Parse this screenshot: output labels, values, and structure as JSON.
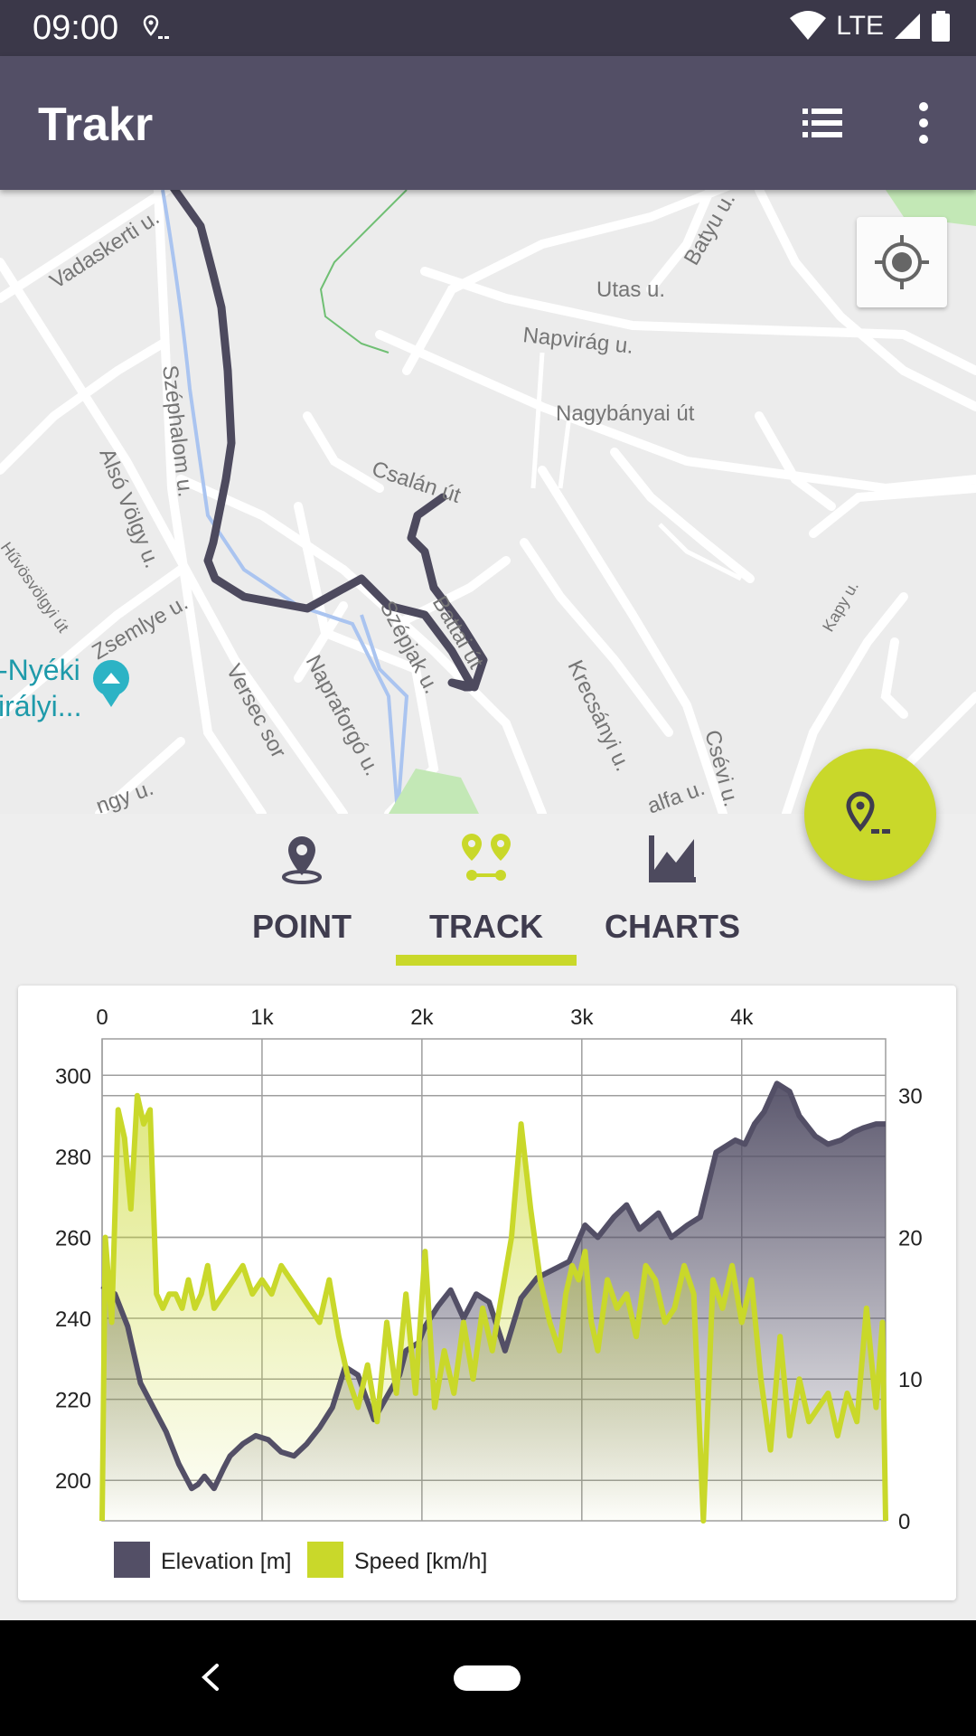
{
  "status_bar": {
    "time": "09:00",
    "network": "LTE"
  },
  "app_bar": {
    "title": "Trakr"
  },
  "map": {
    "street_labels": [
      "Vadaskerti u.",
      "Batyu u.",
      "Utas u.",
      "Napvirág u.",
      "Nagybányai út",
      "Szép­halom u.",
      "Alsó Völgy u.",
      "Csalán út",
      "Hűvösvölgyi út",
      "Zsemlye u.",
      "Szépjak u.",
      "Battai út",
      "Napraforgó u.",
      "Versec sor",
      "Krecsányi u.",
      "Csévi u.",
      "Kapy u.",
      "alfa u.",
      "ngy u."
    ],
    "poi_label_line1": "-Nyéki",
    "poi_label_line2": "irályi..."
  },
  "tabs": [
    {
      "label": "POINT",
      "icon": "map-pin-icon"
    },
    {
      "label": "TRACK",
      "icon": "track-icon"
    },
    {
      "label": "CHARTS",
      "icon": "chart-icon"
    }
  ],
  "active_tab": "TRACK",
  "colors": {
    "primary": "#534f66",
    "accent": "#c9d82a",
    "elevation": "#534f66",
    "speed": "#c9d82a"
  },
  "chart_data": {
    "type": "line",
    "x_label_unit": "m",
    "x_ticks": [
      "0",
      "1k",
      "2k",
      "3k",
      "4k"
    ],
    "x_range": [
      0,
      4900
    ],
    "y_left_ticks": [
      "300",
      "280",
      "260",
      "240",
      "220",
      "200"
    ],
    "y_left_range": [
      190,
      309
    ],
    "y_right_ticks": [
      "30",
      "20",
      "10",
      "0"
    ],
    "y_right_range": [
      0,
      34
    ],
    "grid": true,
    "legend_position": "bottom-left",
    "series": [
      {
        "name": "Elevation [m]",
        "axis": "left",
        "x": [
          0,
          80,
          160,
          240,
          320,
          400,
          480,
          560,
          600,
          640,
          700,
          760,
          800,
          880,
          960,
          1040,
          1120,
          1200,
          1280,
          1360,
          1440,
          1520,
          1600,
          1700,
          1800,
          1860,
          1900,
          1980,
          2020,
          2100,
          2180,
          2260,
          2340,
          2420,
          2520,
          2620,
          2720,
          2820,
          2920,
          3020,
          3100,
          3200,
          3280,
          3360,
          3480,
          3560,
          3660,
          3740,
          3840,
          3960,
          4020,
          4080,
          4140,
          4220,
          4300,
          4360,
          4460,
          4540,
          4620,
          4700,
          4760,
          4840,
          4900
        ],
        "values": [
          248,
          246,
          238,
          224,
          218,
          212,
          204,
          198,
          199,
          201,
          198,
          203,
          206,
          209,
          211,
          210,
          207,
          206,
          209,
          213,
          218,
          228,
          226,
          215,
          222,
          226,
          232,
          234,
          238,
          243,
          247,
          240,
          246,
          244,
          232,
          245,
          250,
          252,
          254,
          263,
          260,
          265,
          268,
          262,
          266,
          260,
          263,
          265,
          281,
          284,
          283,
          288,
          291,
          298,
          296,
          290,
          285,
          283,
          284,
          286,
          287,
          288,
          288
        ]
      },
      {
        "name": "Speed [km/h]",
        "axis": "right",
        "x": [
          0,
          20,
          60,
          100,
          140,
          180,
          220,
          260,
          300,
          340,
          380,
          420,
          460,
          500,
          540,
          580,
          620,
          660,
          700,
          760,
          820,
          880,
          940,
          1000,
          1060,
          1120,
          1180,
          1240,
          1300,
          1360,
          1420,
          1480,
          1540,
          1600,
          1660,
          1720,
          1780,
          1840,
          1900,
          1960,
          2020,
          2080,
          2140,
          2200,
          2260,
          2320,
          2380,
          2440,
          2500,
          2560,
          2620,
          2680,
          2740,
          2800,
          2860,
          2900,
          2940,
          2980,
          3020,
          3060,
          3100,
          3160,
          3220,
          3280,
          3340,
          3400,
          3460,
          3520,
          3580,
          3640,
          3700,
          3760,
          3820,
          3880,
          3940,
          4000,
          4060,
          4120,
          4180,
          4240,
          4300,
          4360,
          4420,
          4480,
          4540,
          4600,
          4660,
          4720,
          4780,
          4840,
          4880,
          4900
        ],
        "values": [
          0,
          20,
          14,
          29,
          27,
          22,
          30,
          28,
          29,
          16,
          15,
          16,
          16,
          15,
          17,
          15,
          16,
          18,
          15,
          16,
          17,
          18,
          16,
          17,
          16,
          18,
          17,
          16,
          15,
          14,
          17,
          13,
          10,
          8,
          11,
          7,
          14,
          9,
          16,
          9,
          19,
          8,
          12,
          9,
          14,
          10,
          15,
          12,
          16,
          20,
          28,
          22,
          17,
          14,
          12,
          16,
          18,
          17,
          19,
          14,
          12,
          17,
          15,
          16,
          13,
          18,
          17,
          14,
          15,
          18,
          16,
          0,
          17,
          15,
          18,
          14,
          17,
          10,
          5,
          13,
          6,
          10,
          7,
          8,
          9,
          6,
          9,
          7,
          15,
          8,
          14,
          0
        ]
      }
    ]
  }
}
